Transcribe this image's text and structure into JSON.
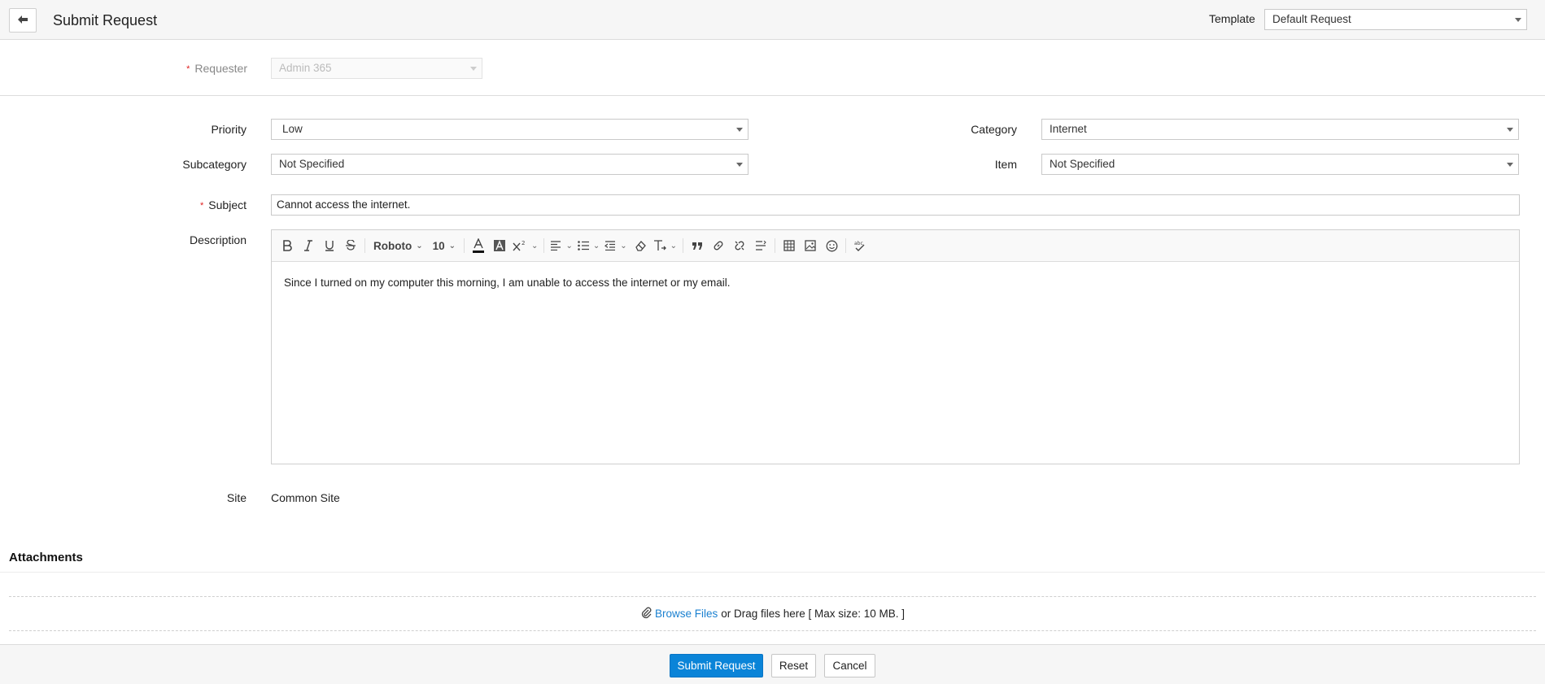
{
  "header": {
    "title": "Submit Request",
    "template_label": "Template",
    "template_value": "Default Request"
  },
  "requester": {
    "label": "Requester",
    "value": "Admin 365"
  },
  "priority": {
    "label": "Priority",
    "value": "Low"
  },
  "category": {
    "label": "Category",
    "value": "Internet"
  },
  "subcategory": {
    "label": "Subcategory",
    "value": "Not Specified"
  },
  "item": {
    "label": "Item",
    "value": "Not Specified"
  },
  "subject": {
    "label": "Subject",
    "value": "Cannot access the internet."
  },
  "description": {
    "label": "Description",
    "font": "Roboto",
    "font_size": "10",
    "text": "Since I turned on my computer this morning, I am unable to access the internet or my email."
  },
  "site": {
    "label": "Site",
    "value": "Common Site"
  },
  "attachments": {
    "title": "Attachments",
    "browse_label": "Browse Files",
    "drag_text": "or Drag files here [ Max size: 10 MB. ]"
  },
  "footer": {
    "submit_label": "Submit Request",
    "reset_label": "Reset",
    "cancel_label": "Cancel"
  },
  "colors": {
    "primary": "#0a84d8",
    "required": "#e02020",
    "link": "#1a80d0"
  }
}
